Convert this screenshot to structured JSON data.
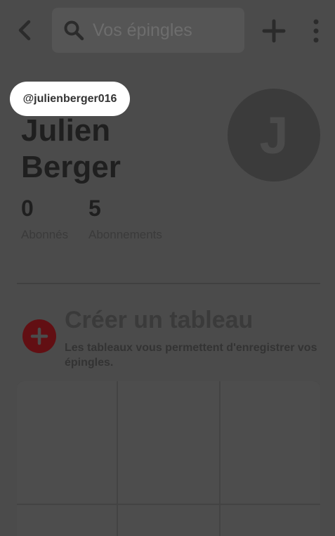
{
  "header": {
    "search_placeholder": "Vos épingles",
    "icons": [
      "back-arrow-icon",
      "search-icon",
      "plus-icon",
      "more-vertical-icon"
    ]
  },
  "profile": {
    "username": "@julienberger016",
    "name_line1": "Julien",
    "name_line2": "Berger",
    "avatar_initial": "J",
    "followers_count": "0",
    "followers_label": "Abonnés",
    "following_count": "5",
    "following_label": "Abonnements"
  },
  "create_board": {
    "title": "Créer un tableau",
    "description": "Les tableaux vous permettent d'enregistrer vos épingles."
  },
  "colors": {
    "overlay": "#4b4b4b",
    "accent": "#620f13",
    "highlight": "#ffffff"
  }
}
